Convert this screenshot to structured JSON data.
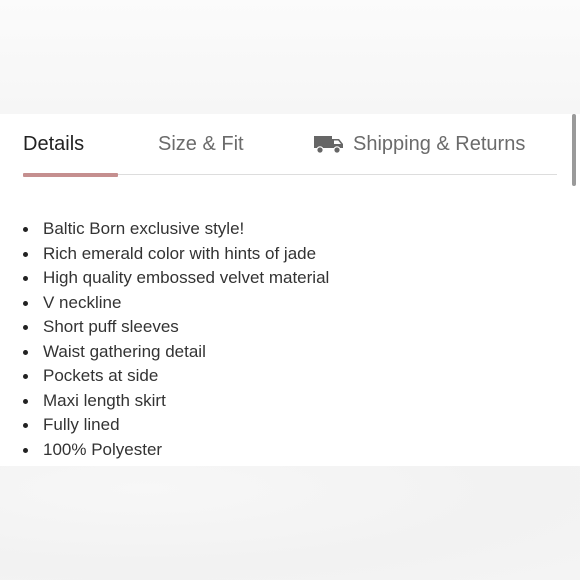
{
  "tabs": {
    "details": "Details",
    "size_fit": "Size & Fit",
    "shipping": "Shipping & Returns",
    "shipping_icon": "truck-icon",
    "active": "Details"
  },
  "colors": {
    "active_indicator": "#c58f8f",
    "active_text": "#222222",
    "inactive_text": "#6b6b6b"
  },
  "details": {
    "items": [
      "Baltic Born exclusive style!",
      "Rich emerald color with hints of jade",
      "High quality embossed velvet material",
      "V neckline",
      "Short puff sleeves",
      "Waist gathering detail",
      "Pockets at side",
      "Maxi length skirt",
      "Fully lined",
      "100% Polyester"
    ]
  }
}
